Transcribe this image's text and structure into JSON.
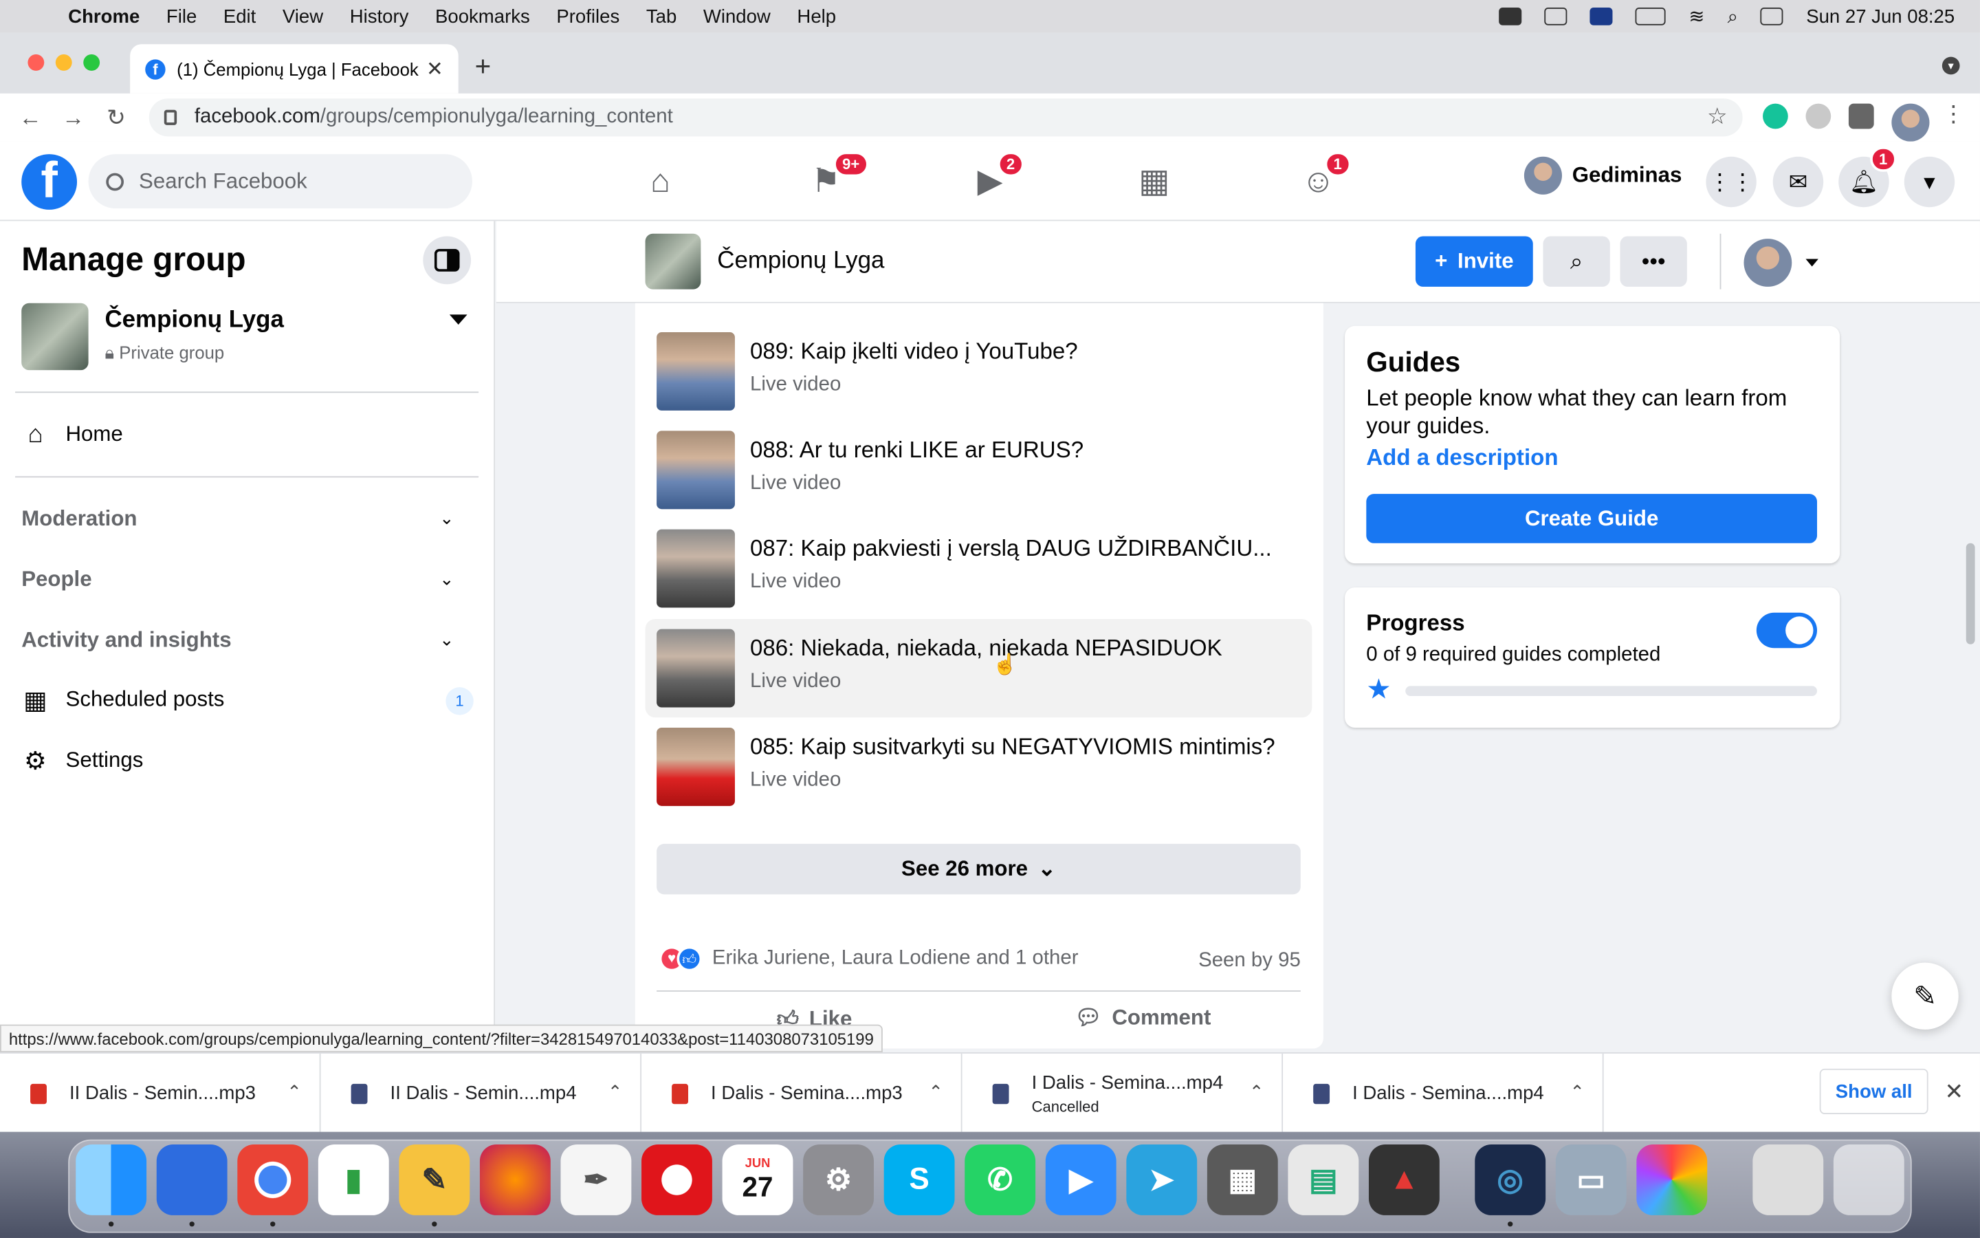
{
  "menubar": {
    "app": "Chrome",
    "items": [
      "File",
      "Edit",
      "View",
      "History",
      "Bookmarks",
      "Profiles",
      "Tab",
      "Window",
      "Help"
    ],
    "clock": "Sun 27 Jun  08:25"
  },
  "browser": {
    "tab_title": "(1) Čempionų Lyga | Facebook",
    "url_host": "facebook.com",
    "url_path": "/groups/cempionulyga/learning_content",
    "status_url": "https://www.facebook.com/groups/cempionulyga/learning_content/?filter=342815497014033&post=1140308073105199"
  },
  "fb_nav": {
    "search_placeholder": "Search Facebook",
    "badges": {
      "pages": "9+",
      "watch": "2",
      "groups": "1",
      "notifications": "1"
    },
    "profile_name": "Gediminas"
  },
  "sidebar": {
    "title": "Manage group",
    "group_name": "Čempionų Lyga",
    "group_privacy": "Private group",
    "home": "Home",
    "sections": [
      "Moderation",
      "People",
      "Activity and insights"
    ],
    "scheduled_posts": "Scheduled posts",
    "scheduled_count": "1",
    "settings": "Settings"
  },
  "group_header": {
    "name": "Čempionų Lyga",
    "invite_label": "Invite"
  },
  "videos": [
    {
      "title": "089: Kaip įkelti video į YouTube?",
      "sub": "Live video"
    },
    {
      "title": "088: Ar tu renki LIKE ar EURUS?",
      "sub": "Live video"
    },
    {
      "title": "087: Kaip pakviesti į verslą DAUG UŽDIRBANČIU...",
      "sub": "Live video"
    },
    {
      "title": "086: Niekada, niekada, niekada NEPASIDUOK",
      "sub": "Live video"
    },
    {
      "title": "085: Kaip susitvarkyti su NEGATYVIOMIS mintimis?",
      "sub": "Live video"
    }
  ],
  "see_more": "See 26 more",
  "reactions": {
    "names": "Erika Juriene, Laura Lodiene and 1 other",
    "seen": "Seen by 95",
    "like": "Like",
    "comment": "Comment"
  },
  "guides": {
    "title": "Guides",
    "description": "Let people know what they can learn from your guides.",
    "add_description": "Add a description",
    "create": "Create Guide"
  },
  "progress": {
    "title": "Progress",
    "subtitle": "0 of 9 required guides completed",
    "completed": 0,
    "required": 9,
    "toggle_on": true
  },
  "downloads": [
    {
      "name": "II Dalis - Semin....mp3",
      "type": "mp3",
      "status": ""
    },
    {
      "name": "II Dalis - Semin....mp4",
      "type": "mp4",
      "status": ""
    },
    {
      "name": "I Dalis - Semina....mp3",
      "type": "mp3",
      "status": ""
    },
    {
      "name": "I Dalis - Semina....mp4",
      "type": "mp4",
      "status": "Cancelled"
    },
    {
      "name": "I Dalis - Semina....mp4",
      "type": "mp4",
      "status": ""
    }
  ],
  "downloads_show_all": "Show all",
  "dock": {
    "calendar_month": "JUN",
    "calendar_day": "27"
  },
  "colors": {
    "fb_blue": "#1877f2",
    "badge_red": "#e41e3f",
    "page_bg": "#f0f2f5"
  }
}
